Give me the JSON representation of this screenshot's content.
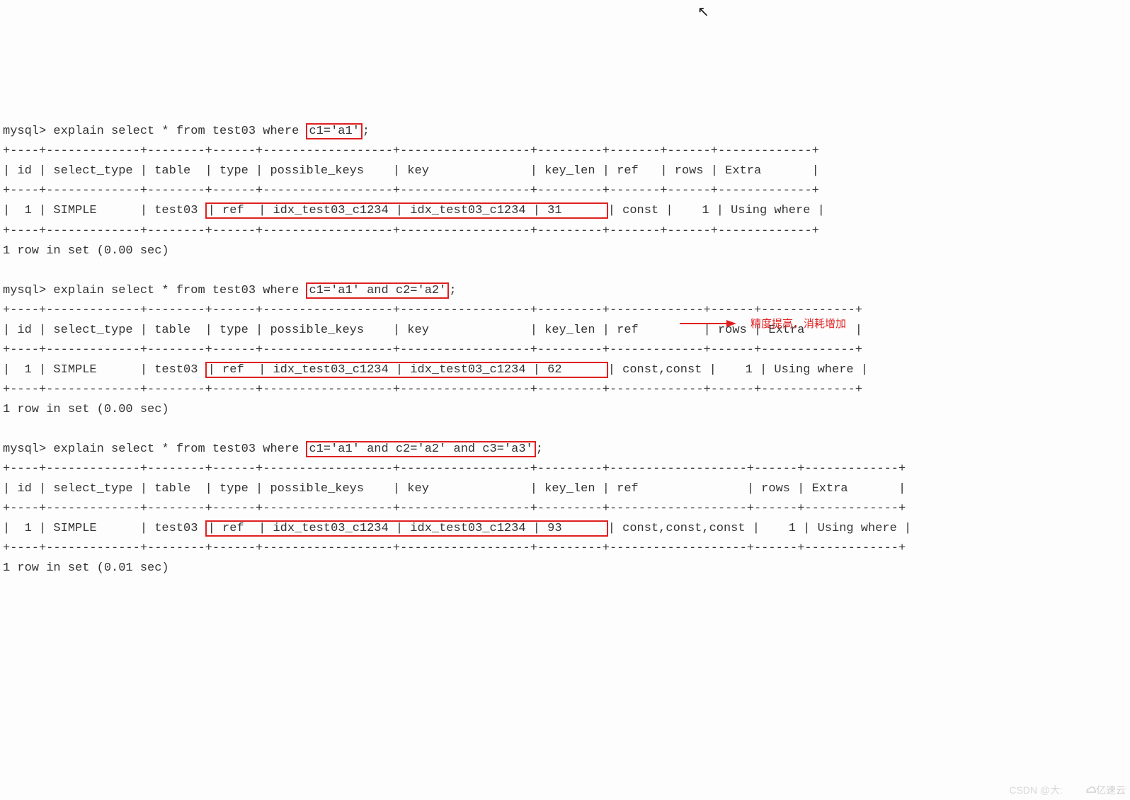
{
  "q1": {
    "prompt": "mysql> explain select * from test03 where ",
    "where_boxed": "c1='a1'",
    "tail": ";",
    "sep": "+----+-------------+--------+------+------------------+------------------+---------+-------+------+-------------+",
    "header": "| id | select_type | table  | type | possible_keys    | key              | key_len | ref   | rows | Extra       |",
    "row_pre": "|  1 | SIMPLE      | test03 ",
    "row_box": "| ref  | idx_test03_c1234 | idx_test03_c1234 | 31      ",
    "row_post": "| const |    1 | Using where |",
    "footer": "1 row in set (0.00 sec)"
  },
  "q2": {
    "prompt": "mysql> explain select * from test03 where ",
    "where_boxed": "c1='a1' and c2='a2'",
    "tail": ";",
    "sep": "+----+-------------+--------+------+------------------+------------------+---------+-------------+------+-------------+",
    "header": "| id | select_type | table  | type | possible_keys    | key              | key_len | ref         | rows | Extra       |",
    "row_pre": "|  1 | SIMPLE      | test03 ",
    "row_box": "| ref  | idx_test03_c1234 | idx_test03_c1234 | 62      ",
    "row_post": "| const,const |    1 | Using where |",
    "footer": "1 row in set (0.00 sec)"
  },
  "q3": {
    "prompt": "mysql> explain select * from test03 where ",
    "where_boxed": "c1='a1' and c2='a2' and c3='a3'",
    "tail": ";",
    "sep": "+----+-------------+--------+------+------------------+------------------+---------+-------------------+------+-------------+",
    "header": "| id | select_type | table  | type | possible_keys    | key              | key_len | ref               | rows | Extra       |",
    "row_pre": "|  1 | SIMPLE      | test03 ",
    "row_box": "| ref  | idx_test03_c1234 | idx_test03_c1234 | 93      ",
    "row_post": "| const,const,const |    1 | Using where |",
    "footer": "1 row in set (0.01 sec)"
  },
  "annotation": "精度提高，消耗增加",
  "watermark_csdn": "CSDN @大:",
  "watermark_yisu": "亿速云"
}
